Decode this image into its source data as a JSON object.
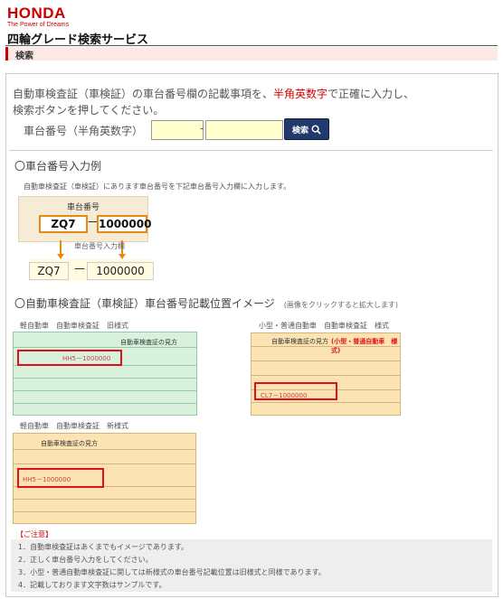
{
  "brand": {
    "logo": "HONDA",
    "tagline": "The Power of Dreams",
    "color": "#cc0000"
  },
  "page": {
    "title": "四輪グレード検索サービス",
    "section": "検索"
  },
  "intro": {
    "line1_before": "自動車検査証（車検証）の車台番号欄の記載事項を、",
    "line1_red": "半角英数字",
    "line1_after": "で正確に入力し、",
    "line2": "検索ボタンを押してください。"
  },
  "form": {
    "label": "車台番号（半角英数字）",
    "part1_value": "",
    "part2_value": "",
    "separator": "-",
    "search_label": "検索",
    "search_icon": "magnifier-icon"
  },
  "example": {
    "heading": "〇車台番号入力例",
    "note": "自動車検査証（車検証）にあります車台番号を下記車台番号入力欄に入力します。",
    "box_label": "車台番号",
    "segment1": "ZQ7",
    "segment2": "1000000",
    "arrow_label": "車台番号入力欄",
    "output1": "ZQ7",
    "output2": "1000000"
  },
  "location": {
    "heading": "〇自動車検査証（車検証）車台番号記載位置イメージ",
    "subnote": "(画像をクリックすると拡大します)",
    "cert_old_caption": "軽自動車　自動車検査証　旧様式",
    "cert_old_title": "自動車検査証の見方",
    "cert_std_caption": "小型・普通自動車　自動車検査証　様式",
    "cert_std_title": "自動車検査証の見方",
    "cert_std_red": "(小型・普通自動車　様式)",
    "cert_new_caption": "軽自動車　自動車検査証　新様式",
    "cert_new_title": "自動車検査証の見方",
    "cert_old_number": "HH5－1000000",
    "cert_std_number": "CL7－1000000",
    "cert_new_number": "HH5－1000000",
    "colors": {
      "green": "#d7f1dd",
      "orange": "#fbe3b3",
      "red": "#e0101a"
    }
  },
  "caution": {
    "title": "【ご注意】",
    "items": [
      "1．自動車検査証はあくまでもイメージであります。",
      "2．正しく車台番号入力をしてください。",
      "3．小型・普通自動車検査証に関しては新様式の車台番号記載位置は旧様式と同様であります。",
      "4．記載しております文字数はサンプルです。"
    ]
  }
}
